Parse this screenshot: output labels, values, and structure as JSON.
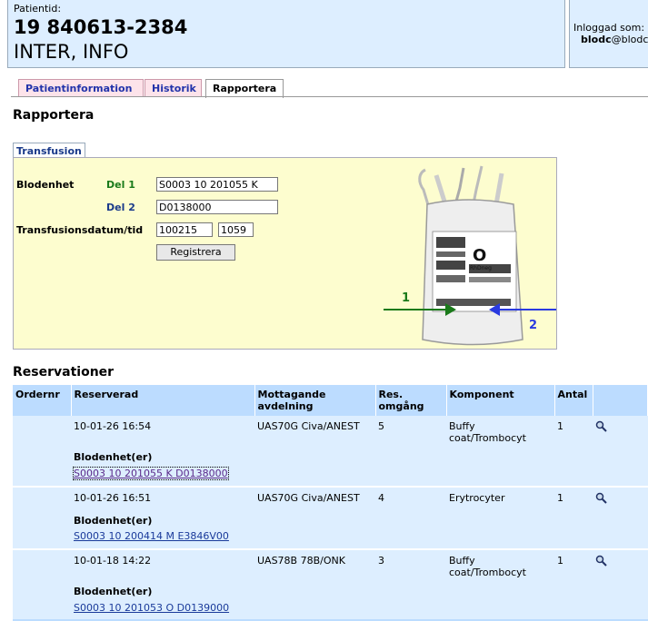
{
  "patient": {
    "label": "Patientid:",
    "id": "19 840613-2384",
    "name": "INTER, INFO"
  },
  "login": {
    "label": "Inloggad som:",
    "user_bold": "blodc",
    "user_rest": "@blodc"
  },
  "tabs": [
    {
      "label": "Patientinformation",
      "active": false
    },
    {
      "label": "Historik",
      "active": false
    },
    {
      "label": "Rapportera",
      "active": true
    }
  ],
  "page_title": "Rapportera",
  "form": {
    "tab_label": "Transfusion",
    "blodenhet_label": "Blodenhet",
    "del1_label": "Del 1",
    "del1_value": "S0003 10 201055 K",
    "del2_label": "Del 2",
    "del2_value": "D0138000",
    "datetime_label": "Transfusionsdatum/tid",
    "date_value": "100215",
    "time_value": "1059",
    "submit_label": "Registrera",
    "image": {
      "blood_group": "O",
      "rh": "RhDneg",
      "arrow1_label": "1",
      "arrow2_label": "2",
      "arrow1_color": "#1a7a1a",
      "arrow2_color": "#2a3ae0"
    }
  },
  "reservations": {
    "title": "Reservationer",
    "headers": {
      "ordernr": "Ordernr",
      "reserverad": "Reserverad",
      "mottagande_1": "Mottagande",
      "mottagande_2": "avdelning",
      "res_1": "Res.",
      "res_2": "omgång",
      "komponent": "Komponent",
      "antal": "Antal"
    },
    "bu_label": "Blodenhet(er)",
    "rows": [
      {
        "ordernr": "",
        "reserverad": "10-01-26 16:54",
        "avdelning": "UAS70G Civa/ANEST",
        "omgang": "5",
        "komponent_1": "Buffy",
        "komponent_2": "coat/Trombocyt",
        "antal": "1",
        "blodenhet": "S0003 10 201055 K D0138000"
      },
      {
        "ordernr": "",
        "reserverad": "10-01-26 16:51",
        "avdelning": "UAS70G Civa/ANEST",
        "omgang": "4",
        "komponent_1": "Erytrocyter",
        "komponent_2": "",
        "antal": "1",
        "blodenhet": "S0003 10 200414 M E3846V00"
      },
      {
        "ordernr": "",
        "reserverad": "10-01-18 14:22",
        "avdelning": "UAS78B 78B/ONK",
        "omgang": "3",
        "komponent_1": "Buffy",
        "komponent_2": "coat/Trombocyt",
        "antal": "1",
        "blodenhet": "S0003 10 201053 O D0139000"
      }
    ]
  },
  "colors": {
    "header_bg": "#ddeeff",
    "panel_bg": "#fdfdcf",
    "table_header_bg": "#bcdcff",
    "tab_inactive_bg": "#fde3ea",
    "del1_color": "#1a7a1a",
    "del2_color": "#1a3a8a"
  }
}
